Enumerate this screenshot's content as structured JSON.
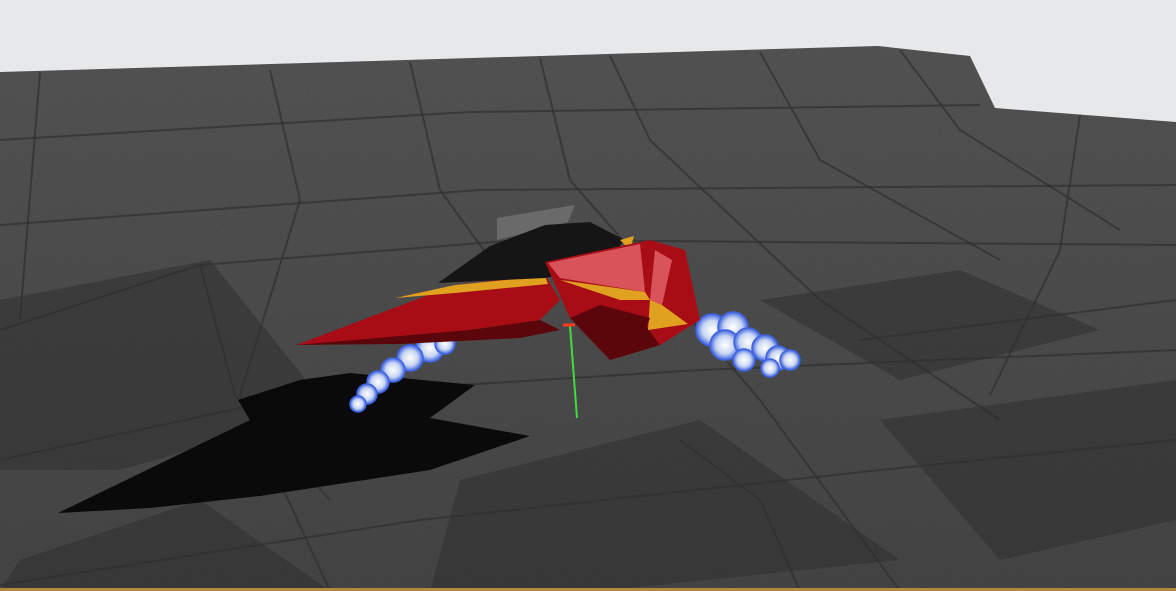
{
  "scene": {
    "sky_color": "#e6e8ea",
    "terrain_top_color": "#4a4a4a",
    "terrain_bottom_color": "#3b3b3b",
    "panel_line_color": "#2f2f2f",
    "shadow_color": "#050505",
    "border_color": "#b08a3a",
    "ship": {
      "hull_primary": "#a80d16",
      "hull_highlight": "#d9545a",
      "hull_dark": "#5a060a",
      "cockpit": "#151515",
      "trim": "#e0a020",
      "fin": "#6a6a6a"
    },
    "thruster_smoke_color": "#c9d6f2",
    "thruster_glow_color": "#3f63e0",
    "gizmo_axis_color": "#3fdc3f",
    "gizmo_origin_color": "#ff3b1f"
  }
}
